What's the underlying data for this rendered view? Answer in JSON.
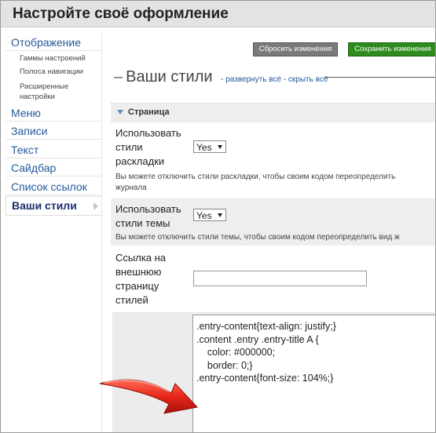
{
  "header": {
    "title": "Настройте своё оформление"
  },
  "sidebar": {
    "items": [
      {
        "label": "Отображение"
      },
      {
        "label": "Меню"
      },
      {
        "label": "Записи"
      },
      {
        "label": "Текст"
      },
      {
        "label": "Сайдбар"
      },
      {
        "label": "Список ссылок"
      },
      {
        "label": "Ваши стили"
      }
    ],
    "subitems": [
      {
        "label": "Гаммы настроений"
      },
      {
        "label": "Полоса навигации"
      },
      {
        "label": "Расширенные настройки"
      }
    ]
  },
  "toolbar": {
    "reset_label": "Сбросить изменения",
    "save_label": "Сохранить изменения"
  },
  "section": {
    "title": "Ваши стили",
    "expand_all": "развернуть всё",
    "separator": "-",
    "collapse_all": "скрыть всё"
  },
  "panel": {
    "title": "Страница"
  },
  "options": {
    "layout_styles": {
      "label": "Использовать стили раскладки",
      "value": "Yes",
      "hint_line1": "Вы можете отключить стили раскладки, чтобы своим кодом переопределить",
      "hint_line2": "журнала"
    },
    "theme_styles": {
      "label": "Использовать стили темы",
      "value": "Yes",
      "hint_line1": "Вы можете отключить стили темы, чтобы своим кодом переопределить вид ж"
    },
    "external_link": {
      "label": "Ссылка на внешнюю страницу стилей",
      "value": ""
    }
  },
  "css_editor": {
    "lines": [
      ".entry-content{text-align: justify;}",
      "",
      ".content .entry .entry-title A {",
      "    color: #000000;",
      "    border: 0;}",
      "",
      ".entry-content{font-size: 104%;}"
    ]
  },
  "colors": {
    "link": "#23599a",
    "save_button": "#2e8b1e",
    "reset_button": "#7a7a7a",
    "annotation_arrow": "#e8261a"
  }
}
